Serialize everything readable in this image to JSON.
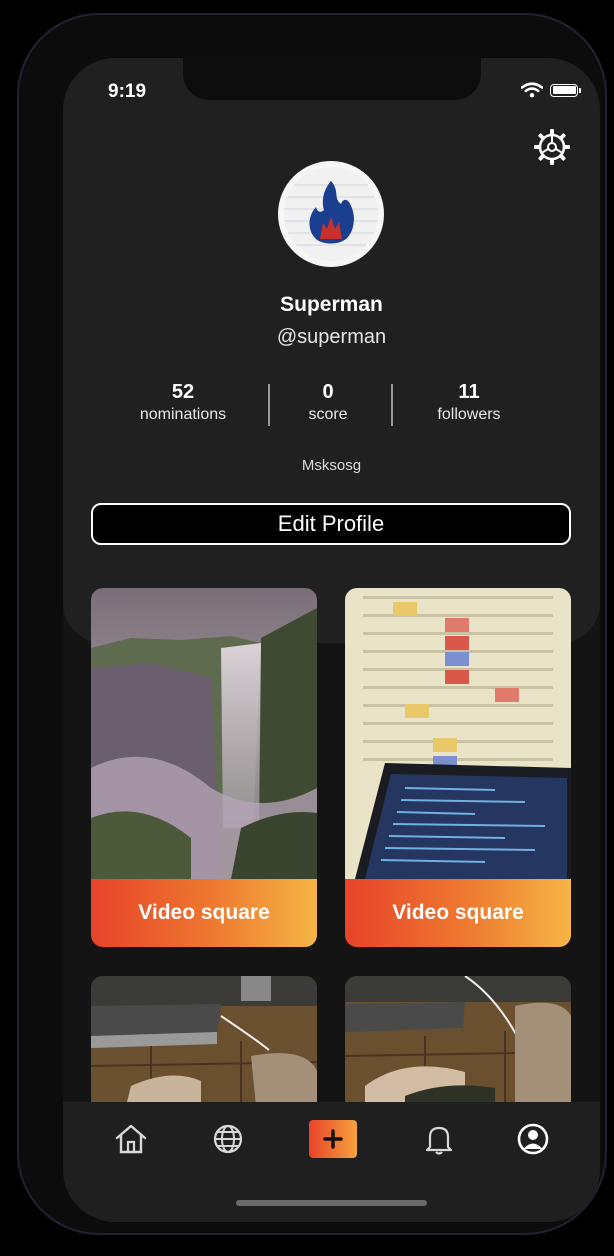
{
  "status_bar": {
    "time": "9:19"
  },
  "profile": {
    "name": "Superman",
    "handle": "@superman",
    "bio": "Msksosg",
    "stats": [
      {
        "value": "52",
        "label": "nominations"
      },
      {
        "value": "0",
        "label": "score"
      },
      {
        "value": "11",
        "label": "followers"
      }
    ],
    "edit_label": "Edit Profile"
  },
  "posts": [
    {
      "label": "Video square",
      "image": "waterfall-photo"
    },
    {
      "label": "Video square",
      "image": "laptop-and-chart-photo"
    },
    {
      "image": "desk-laptop-knees-photo"
    },
    {
      "image": "desk-laptop-knees-photo"
    }
  ],
  "tabbar": {
    "items": [
      "home-icon",
      "globe-icon",
      "add-icon",
      "bell-icon",
      "profile-icon"
    ],
    "accent_gradient": [
      "#e8432a",
      "#f6b545"
    ]
  }
}
